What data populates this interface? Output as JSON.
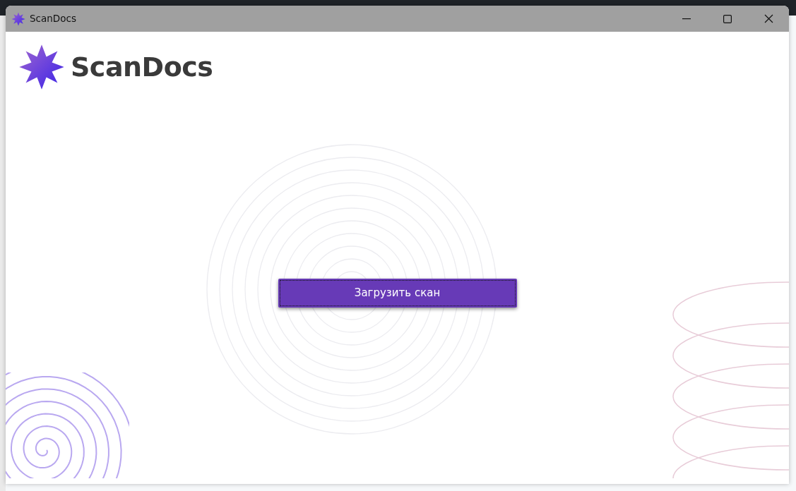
{
  "window": {
    "title": "ScanDocs"
  },
  "logo": {
    "text": "ScanDocs"
  },
  "upload_button": {
    "label": "Загрузить скан",
    "focused": true
  }
}
